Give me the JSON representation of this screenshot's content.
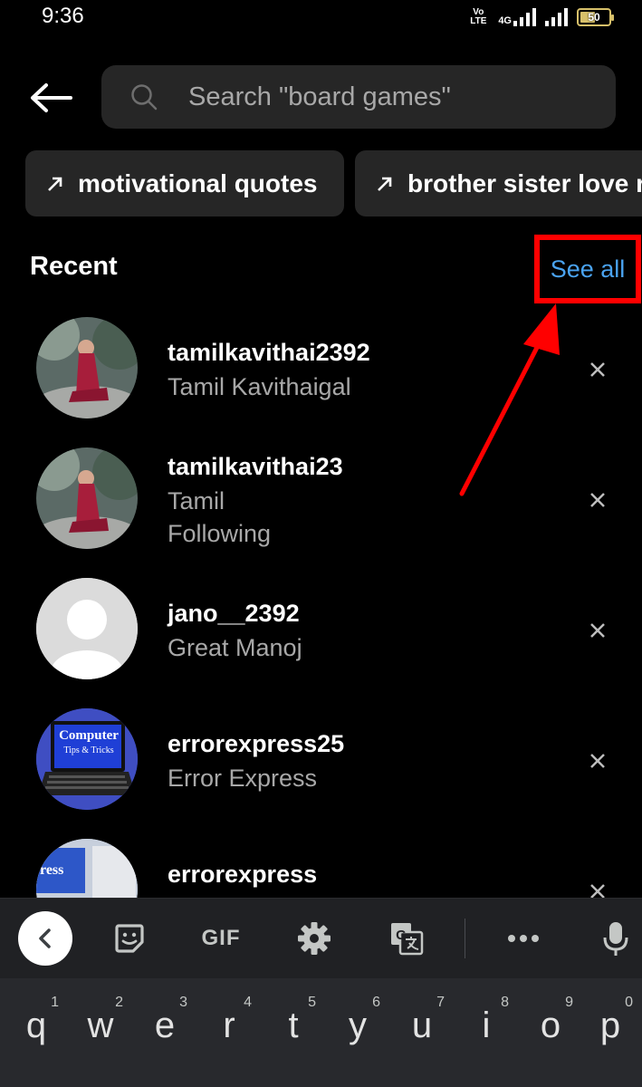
{
  "status_bar": {
    "time": "9:36",
    "volte_line1": "Vo",
    "volte_line2": "LTE",
    "network": "4G",
    "battery_level": "50",
    "battery_color": "#d7c06a"
  },
  "header": {
    "back_icon": "arrow-left-icon",
    "search_placeholder": "Search \"board games\"",
    "search_value": ""
  },
  "suggestions": [
    {
      "label": "motivational quotes",
      "icon": "trend-arrow-icon"
    },
    {
      "label": "brother sister love r",
      "icon": "trend-arrow-icon"
    }
  ],
  "recent": {
    "title": "Recent",
    "see_all_label": "See all",
    "link_color": "#4aa3f0",
    "highlight_color": "#ff0000",
    "items": [
      {
        "username": "tamilkavithai2392",
        "subtitle": "Tamil Kavithaigal",
        "subtitle2": ""
      },
      {
        "username": "tamilkavithai23",
        "subtitle": "Tamil",
        "subtitle2": "Following"
      },
      {
        "username": "jano__2392",
        "subtitle": "Great Manoj",
        "subtitle2": ""
      },
      {
        "username": "errorexpress25",
        "subtitle": "Error Express",
        "subtitle2": ""
      },
      {
        "username": "errorexpress",
        "subtitle": "",
        "subtitle2": ""
      }
    ],
    "avatar_texts": {
      "computer": "Computer",
      "tips": "Tips & Tricks",
      "partial": "ress"
    }
  },
  "keyboard": {
    "toolbar": {
      "gif_label": "GIF",
      "icons": [
        "chevron-left-icon",
        "sticker-icon",
        "gear-icon",
        "translate-icon",
        "more-icon",
        "microphone-icon"
      ]
    },
    "keys": [
      {
        "hint": "1",
        "letter": "q"
      },
      {
        "hint": "2",
        "letter": "w"
      },
      {
        "hint": "3",
        "letter": "e"
      },
      {
        "hint": "4",
        "letter": "r"
      },
      {
        "hint": "5",
        "letter": "t"
      },
      {
        "hint": "6",
        "letter": "y"
      },
      {
        "hint": "7",
        "letter": "u"
      },
      {
        "hint": "8",
        "letter": "i"
      },
      {
        "hint": "9",
        "letter": "o"
      },
      {
        "hint": "0",
        "letter": "p"
      }
    ]
  }
}
